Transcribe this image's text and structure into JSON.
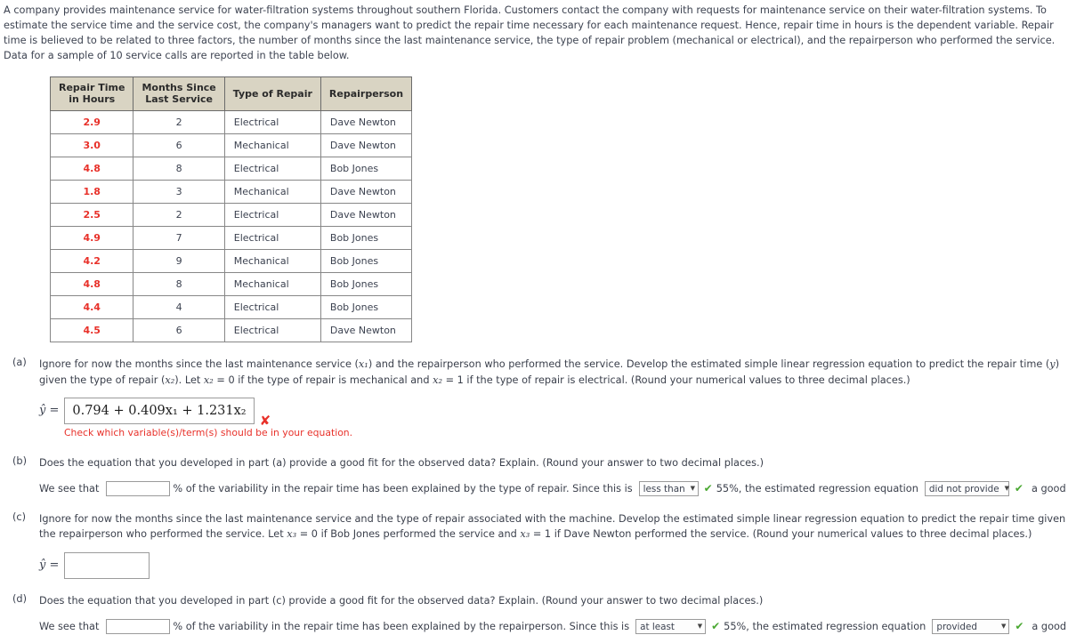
{
  "intro": {
    "paragraph": "A company provides maintenance service for water-filtration systems throughout southern Florida. Customers contact the company with requests for maintenance service on their water-filtration systems. To estimate the service time and the service cost, the company's managers want to predict the repair time necessary for each maintenance request. Hence, repair time in hours is the dependent variable. Repair time is believed to be related to three factors, the number of months since the last maintenance service, the type of repair problem (mechanical or electrical), and the repairperson who performed the service. Data for a sample of 10 service calls are reported in the table below."
  },
  "table": {
    "headers": [
      "Repair Time in Hours",
      "Months Since Last Service",
      "Type of Repair",
      "Repairperson"
    ],
    "header_lines": [
      [
        "Repair Time",
        "in Hours"
      ],
      [
        "Months Since",
        "Last Service"
      ],
      [
        "Type of Repair"
      ],
      [
        "Repairperson"
      ]
    ],
    "rows": [
      {
        "repair_time": "2.9",
        "months": "2",
        "type": "Electrical",
        "person": "Dave Newton"
      },
      {
        "repair_time": "3.0",
        "months": "6",
        "type": "Mechanical",
        "person": "Dave Newton"
      },
      {
        "repair_time": "4.8",
        "months": "8",
        "type": "Electrical",
        "person": "Bob Jones"
      },
      {
        "repair_time": "1.8",
        "months": "3",
        "type": "Mechanical",
        "person": "Dave Newton"
      },
      {
        "repair_time": "2.5",
        "months": "2",
        "type": "Electrical",
        "person": "Dave Newton"
      },
      {
        "repair_time": "4.9",
        "months": "7",
        "type": "Electrical",
        "person": "Bob Jones"
      },
      {
        "repair_time": "4.2",
        "months": "9",
        "type": "Mechanical",
        "person": "Bob Jones"
      },
      {
        "repair_time": "4.8",
        "months": "8",
        "type": "Mechanical",
        "person": "Bob Jones"
      },
      {
        "repair_time": "4.4",
        "months": "4",
        "type": "Electrical",
        "person": "Bob Jones"
      },
      {
        "repair_time": "4.5",
        "months": "6",
        "type": "Electrical",
        "person": "Dave Newton"
      }
    ]
  },
  "parts": {
    "a": {
      "label": "(a)",
      "text_1": "Ignore for now the months since the last maintenance service (",
      "text_2": ") and the repairperson who performed the service. Develop the estimated simple linear regression equation to predict the repair time (",
      "text_3": ") given the type of repair (",
      "text_4": "). Let ",
      "text_5": " = 0 if the type of repair is mechanical and ",
      "text_6": " = 1 if the type of repair is electrical. (Round your numerical values to three decimal places.)",
      "yhat_label": "ŷ =",
      "answer_value": "0.794 + 0.409x₁ + 1.231x₂",
      "wrong_mark": "✘",
      "feedback": "Check which variable(s)/term(s) should be in your equation."
    },
    "b": {
      "label": "(b)",
      "question": "Does the equation that you developed in part (a) provide a good fit for the observed data? Explain. (Round your answer to two decimal places.)",
      "lead": "We see that",
      "input_value": "",
      "mid_1": "% of the variability in the repair time has been explained by the type of repair. Since this is",
      "select_1_value": "less than",
      "check_1": "✔",
      "mid_2": "55%, the estimated regression equation",
      "select_2_value": "did not provide",
      "check_2": "✔",
      "tail": "a good fit for the observed data."
    },
    "c": {
      "label": "(c)",
      "text_1": "Ignore for now the months since the last maintenance service and the type of repair associated with the machine. Develop the estimated simple linear regression equation to predict the repair time given the repairperson who performed the service. Let ",
      "text_2": " = 0 if Bob Jones performed the service and ",
      "text_3": " = 1 if Dave Newton performed the service. (Round your numerical values to three decimal places.)",
      "yhat_label": "ŷ =",
      "answer_value": ""
    },
    "d": {
      "label": "(d)",
      "question": "Does the equation that you developed in part (c) provide a good fit for the observed data? Explain. (Round your answer to two decimal places.)",
      "lead": "We see that",
      "input_value": "",
      "mid_1": "% of the variability in the repair time has been explained by the repairperson. Since this is",
      "select_1_value": "at least",
      "check_1": "✔",
      "mid_2": "55%, the estimated regression equation",
      "select_2_value": "provided",
      "check_2": "✔",
      "tail": "a good fit for the observed data."
    }
  },
  "variables": {
    "x1": "x₁",
    "x2": "x₂",
    "x3": "x₃",
    "y": "y"
  },
  "colors": {
    "header_bg": "#d9d4c3",
    "red": "#e8312a",
    "green": "#4aa832",
    "text": "#3c4250"
  }
}
